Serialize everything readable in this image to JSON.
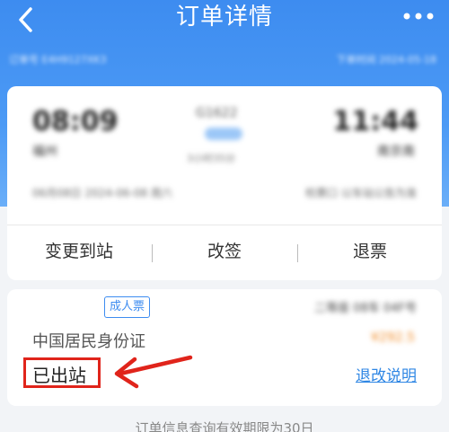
{
  "header": {
    "title": "订单详情",
    "back_icon": "chevron-left-icon",
    "more_icon": "more-dots-icon"
  },
  "order_strip": {
    "order_no": "订单号 E4H9127XK3",
    "created": "下单时间 2024-05-18"
  },
  "trip": {
    "departure_time": "08:09",
    "departure_station": "福州",
    "arrival_time": "11:44",
    "arrival_station": "南京南",
    "train_no": "G1622",
    "duration": "3小时35分",
    "date_info": "06月08日 2024-06-08 周六",
    "gate_info": "检票口 以车站公告为准"
  },
  "actions": [
    {
      "label": "变更到站"
    },
    {
      "label": "改签"
    },
    {
      "label": "退票"
    }
  ],
  "ticket": {
    "ticket_type": "成人票",
    "seat": "二等座 08车 04F号",
    "id_type": "中国居民身份证",
    "price": "¥292.5",
    "status": "已出站",
    "refund_link": "退改说明"
  },
  "footer": {
    "note": "订单信息查询有效期限为30日"
  },
  "colors": {
    "brand_blue": "#3d8cf0",
    "highlight_red": "#e0241b",
    "link_blue": "#2e86e4"
  }
}
